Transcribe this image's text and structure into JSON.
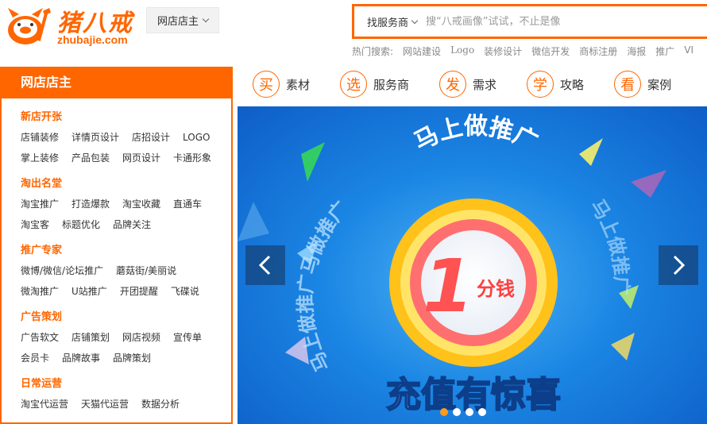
{
  "logo": {
    "cn": "猪八戒",
    "en": "zhubajie.com"
  },
  "city_select": {
    "label": "网店店主"
  },
  "search": {
    "type_label": "找服务商",
    "placeholder": "搜“八戒画像”试试，不止是像"
  },
  "hot_search": {
    "label": "热门搜索:",
    "items": [
      "网站建设",
      "Logo",
      "装修设计",
      "微信开发",
      "商标注册",
      "海报",
      "推广",
      "VI"
    ]
  },
  "sidebar": {
    "title": "网店店主",
    "groups": [
      {
        "title": "新店开张",
        "rows": [
          [
            "店铺装修",
            "详情页设计",
            "店招设计",
            "LOGO"
          ],
          [
            "掌上装修",
            "产品包装",
            "网页设计",
            "卡通形象"
          ]
        ]
      },
      {
        "title": "淘出名堂",
        "rows": [
          [
            "淘宝推广",
            "打造爆款",
            "淘宝收藏",
            "直通车"
          ],
          [
            "淘宝客",
            "标题优化",
            "品牌关注"
          ]
        ]
      },
      {
        "title": "推广专家",
        "rows": [
          [
            "微博/微信/论坛推广",
            "蘑菇街/美丽说"
          ],
          [
            "微淘推广",
            "U站推广",
            "开团提醒",
            "飞碟说"
          ]
        ]
      },
      {
        "title": "广告策划",
        "rows": [
          [
            "广告软文",
            "店铺策划",
            "网店视频",
            "宣传单"
          ],
          [
            "会员卡",
            "品牌故事",
            "品牌策划"
          ]
        ]
      },
      {
        "title": "日常运营",
        "rows": [
          [
            "淘宝代运营",
            "天猫代运营",
            "数据分析"
          ]
        ]
      }
    ]
  },
  "nav": [
    {
      "icon_char": "买",
      "label": "素材"
    },
    {
      "icon_char": "选",
      "label": "服务商"
    },
    {
      "icon_char": "发",
      "label": "需求"
    },
    {
      "icon_char": "学",
      "label": "攻略"
    },
    {
      "icon_char": "看",
      "label": "案例"
    }
  ],
  "banner": {
    "arc_text": "马上做推广",
    "left_arc_text": "马上做推广马做推广",
    "right_arc_text": "马上做推广",
    "big_number": "1",
    "unit_text": "分钱",
    "slogan": "充值有惊喜",
    "active_dot": 0,
    "dot_count": 4
  },
  "colors": {
    "accent": "#ff6600",
    "banner_blue": "#1b86e4"
  }
}
